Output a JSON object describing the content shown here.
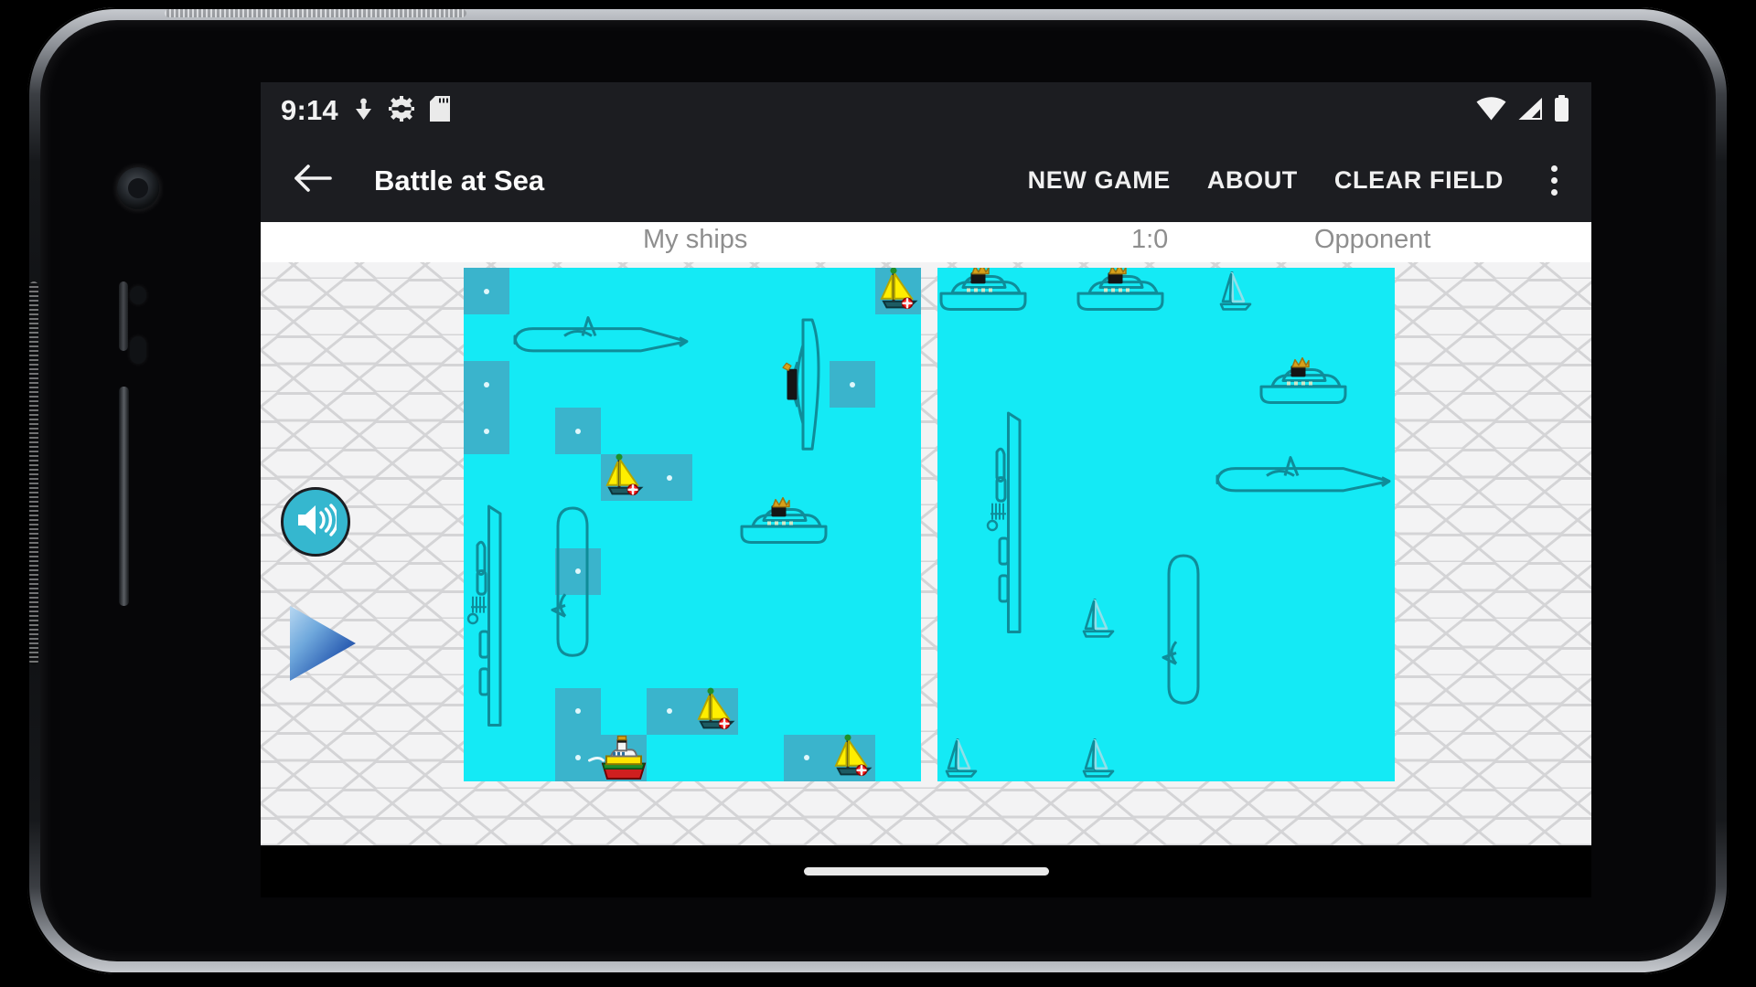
{
  "device": {
    "side_buttons": [
      "volume-up",
      "volume-down",
      "power"
    ]
  },
  "status_bar": {
    "clock": "9:14",
    "left_icons": [
      "download-icon",
      "gear-icon",
      "sd-card-icon"
    ],
    "right_icons": [
      "wifi-icon",
      "cellular-signal-icon",
      "battery-icon"
    ]
  },
  "toolbar": {
    "back_icon": "back-arrow-icon",
    "title": "Battle at Sea",
    "actions": [
      {
        "label": "NEW GAME",
        "name": "new-game-button"
      },
      {
        "label": "ABOUT",
        "name": "about-button"
      },
      {
        "label": "CLEAR FIELD",
        "name": "clear-field-button"
      }
    ],
    "overflow_icon": "overflow-menu-icon"
  },
  "game": {
    "labels": {
      "my_ships": "My ships",
      "score": "1:0",
      "opponent": "Opponent"
    },
    "controls": {
      "sound_icon": "speaker-on-icon",
      "play_icon": "play-arrow-icon"
    },
    "board_size": {
      "cols": 10,
      "rows": 11,
      "cell": 50
    },
    "my_board": {
      "misses": [
        {
          "c": 0,
          "r": 0
        },
        {
          "c": 0,
          "r": 2
        },
        {
          "c": 0,
          "r": 3
        },
        {
          "c": 2,
          "r": 3
        },
        {
          "c": 3,
          "r": 4
        },
        {
          "c": 4,
          "r": 4
        },
        {
          "c": 8,
          "r": 2
        },
        {
          "c": 2,
          "r": 6
        },
        {
          "c": 2,
          "r": 9
        },
        {
          "c": 4,
          "r": 9
        },
        {
          "c": 5,
          "r": 9
        },
        {
          "c": 2,
          "r": 10
        },
        {
          "c": 7,
          "r": 10
        },
        {
          "c": 8,
          "r": 10
        }
      ],
      "hits": [
        {
          "c": 9,
          "r": 0,
          "icon": "sailboat-hit-icon"
        },
        {
          "c": 3,
          "r": 4,
          "icon": "sailboat-hit-icon"
        },
        {
          "c": 5,
          "r": 9,
          "icon": "sailboat-hit-icon"
        },
        {
          "c": 8,
          "r": 10,
          "icon": "sailboat-hit-icon"
        },
        {
          "c": 3,
          "r": 10,
          "icon": "tugboat-hit-icon"
        }
      ],
      "ships": [
        {
          "icon": "submarine-icon",
          "orientation": "horizontal",
          "c": 1,
          "r": 1,
          "len": 4
        },
        {
          "icon": "destroyer-icon",
          "orientation": "vertical",
          "c": 7,
          "r": 1,
          "len": 3
        },
        {
          "icon": "aircraft-carrier-icon",
          "orientation": "vertical",
          "c": 0,
          "r": 5,
          "len": 5
        },
        {
          "icon": "submarine-vertical-icon",
          "orientation": "vertical",
          "c": 2,
          "r": 5,
          "len": 4
        },
        {
          "icon": "cruiser-icon",
          "orientation": "horizontal",
          "c": 6,
          "r": 5,
          "len": 2
        }
      ]
    },
    "opponent_board": {
      "ships": [
        {
          "icon": "cruiser-icon",
          "orientation": "horizontal",
          "c": 0,
          "r": 0,
          "len": 2
        },
        {
          "icon": "cruiser-icon",
          "orientation": "horizontal",
          "c": 3,
          "r": 0,
          "len": 2
        },
        {
          "icon": "sailboat-icon",
          "orientation": "single",
          "c": 6,
          "r": 0,
          "len": 1
        },
        {
          "icon": "cruiser-icon",
          "orientation": "horizontal",
          "c": 7,
          "r": 2,
          "len": 2
        },
        {
          "icon": "aircraft-carrier-icon",
          "orientation": "vertical",
          "c": 1,
          "r": 3,
          "len": 5
        },
        {
          "icon": "submarine-icon",
          "orientation": "horizontal",
          "c": 6,
          "r": 4,
          "len": 4
        },
        {
          "icon": "sailboat-icon",
          "orientation": "single",
          "c": 3,
          "r": 7,
          "len": 1
        },
        {
          "icon": "submarine-vertical-icon",
          "orientation": "vertical",
          "c": 5,
          "r": 6,
          "len": 4
        },
        {
          "icon": "sailboat-icon",
          "orientation": "single",
          "c": 0,
          "r": 10,
          "len": 1
        },
        {
          "icon": "sailboat-icon",
          "orientation": "single",
          "c": 3,
          "r": 10,
          "len": 1
        }
      ]
    }
  },
  "nav_bar": {
    "home_indicator": "home-pill-indicator"
  }
}
